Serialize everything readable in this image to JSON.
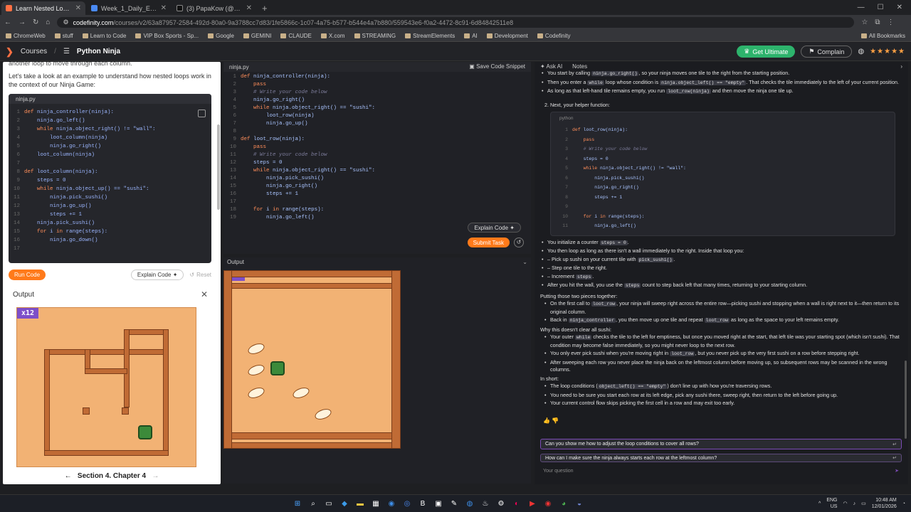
{
  "browser": {
    "tabs": [
      {
        "title": "Learn Nested Loops | Loops"
      },
      {
        "title": "Week_1_Daily_Exercise_Guide.d"
      },
      {
        "title": "(3) PapaKow (@papakowkow) /"
      }
    ],
    "url_domain": "codefinity.com",
    "url_path": "/courses/v2/63a87957-2584-492d-80a0-9a3788cc7d83/1fe5866c-1c07-4a75-b577-b544e4a7b880/559543e6-f0a2-4472-8c91-6d84842511e8",
    "bookmarks": [
      "ChromeWeb",
      "stuff",
      "Learn to Code",
      "VIP Box Sports - Sp...",
      "Google",
      "GEMINI",
      "CLAUDE",
      "X.com",
      "STREAMING",
      "StreamElements",
      "AI",
      "Development",
      "Codefinity"
    ],
    "all_bookmarks": "All Bookmarks"
  },
  "header": {
    "courses": "Courses",
    "course_title": "Python Ninja",
    "get_ultimate": "Get Ultimate",
    "complain": "Complain",
    "stars": "★★★★★"
  },
  "lesson": {
    "intro_cut": "another loop to move through each column.",
    "intro": "Let's take a look at an example to understand how nested loops work in the context of our Ninja Game:",
    "file_tab": "ninja.py",
    "code_lines": [
      "def ninja_controller(ninja):",
      "    ninja.go_left()",
      "    while ninja.object_right() != \"wall\":",
      "        loot_column(ninja)",
      "        ninja.go_right()",
      "    loot_column(ninja)",
      "",
      "def loot_column(ninja):",
      "    steps = 0",
      "    while ninja.object_up() == \"sushi\":",
      "        ninja.pick_sushi()",
      "        ninja.go_up()",
      "        steps += 1",
      "    ninja.pick_sushi()",
      "    for i in range(steps):",
      "        ninja.go_down()",
      ""
    ],
    "run_code": "Run Code",
    "explain_code": "Explain Code",
    "reset": "Reset",
    "output_title": "Output",
    "counter": "x12",
    "section_nav": "Section 4. Chapter 4"
  },
  "editor": {
    "file_tab": "ninja.py",
    "save_snippet": "Save Code Snippet",
    "code_lines": [
      "def ninja_controller(ninja):",
      "    pass",
      "    # Write your code below",
      "    ninja.go_right()",
      "    while ninja.object_right() == \"sushi\":",
      "        loot_row(ninja)",
      "        ninja.go_up()",
      "",
      "def loot_row(ninja):",
      "    pass",
      "    # Write your code below",
      "    steps = 0",
      "    while ninja.object_right() == \"sushi\":",
      "        ninja.pick_sushi()",
      "        ninja.go_right()",
      "        steps += 1",
      "",
      "    for i in range(steps):",
      "        ninja.go_left()"
    ],
    "explain_code": "Explain Code",
    "submit_task": "Submit Task",
    "output_title": "Output",
    "counter": "x03"
  },
  "ai": {
    "tab_ask": "Ask AI",
    "tab_notes": "Notes",
    "top_bullets": [
      "You start by calling [ninja.go_right()], so your ninja moves one tile to the right from the starting position.",
      "Then you enter a [while] loop whose condition is [ninja.object_left() == \"empty\"]. That checks the tile immediately to the left of your current position.",
      "As long as that left-hand tile remains empty, you run [loot_row(ninja)] and then move the ninja one tile up."
    ],
    "helper_heading": "2. Next, your helper function:",
    "snippet_lang": "python",
    "snippet_lines": [
      "def loot_row(ninja):",
      "    pass",
      "    # Write your code below",
      "    steps = 0",
      "    while ninja.object_right() != \"wall\":",
      "        ninja.pick_sushi()",
      "        ninja.go_right()",
      "        steps += 1",
      "",
      "    for i in range(steps):",
      "        ninja.go_left()"
    ],
    "mid_bullets": [
      "You initialize a counter [steps = 0].",
      "You then loop as long as there isn't a wall immediately to the right. Inside that loop you:",
      "– Pick up sushi on your current tile with [pick_sushi()].",
      "– Step one tile to the right.",
      "– Increment [steps].",
      "After you hit the wall, you use the [steps] count to step back left that many times, returning to your starting column."
    ],
    "together_heading": "Putting those two pieces together:",
    "together_bullets": [
      "On the first call to [loot_row], your ninja will sweep right across the entire row—picking sushi and stopping when a wall is right next to it—then return to its original column.",
      "Back in [ninja_controller], you then move up one tile and repeat [loot_row] as long as the space to your left remains empty."
    ],
    "why_heading": "Why this doesn't clear all sushi:",
    "why_bullets": [
      "Your outer [while] checks the tile to the left for emptiness, but once you moved right at the start, that left tile was your starting spot (which isn't sushi). That condition may become false immediately, so you might never loop to the next row.",
      "You only ever pick sushi when you're moving right in [loot_row], but you never pick up the very first sushi on a row before stepping right.",
      "After sweeping each row you never place the ninja back on the leftmost column before moving up, so subsequent rows may be scanned in the wrong columns."
    ],
    "short_heading": "In short:",
    "short_bullets": [
      "The loop conditions ([object_left() == \"empty\"]) don't line up with how you're traversing rows.",
      "You need to be sure you start each row at its left edge, pick any sushi there, sweep right, then return to the left before going up.",
      "Your current control flow skips picking the first cell in a row and may exit too early."
    ],
    "suggestion_1": "Can you show me how to adjust the loop conditions to cover all rows?",
    "suggestion_2": "How can I make sure the ninja always starts each row at the leftmost column?",
    "question_placeholder": "Your question"
  },
  "taskbar": {
    "lang": "ENG",
    "region": "US",
    "time": "10:48 AM",
    "date": "12/01/2026"
  }
}
